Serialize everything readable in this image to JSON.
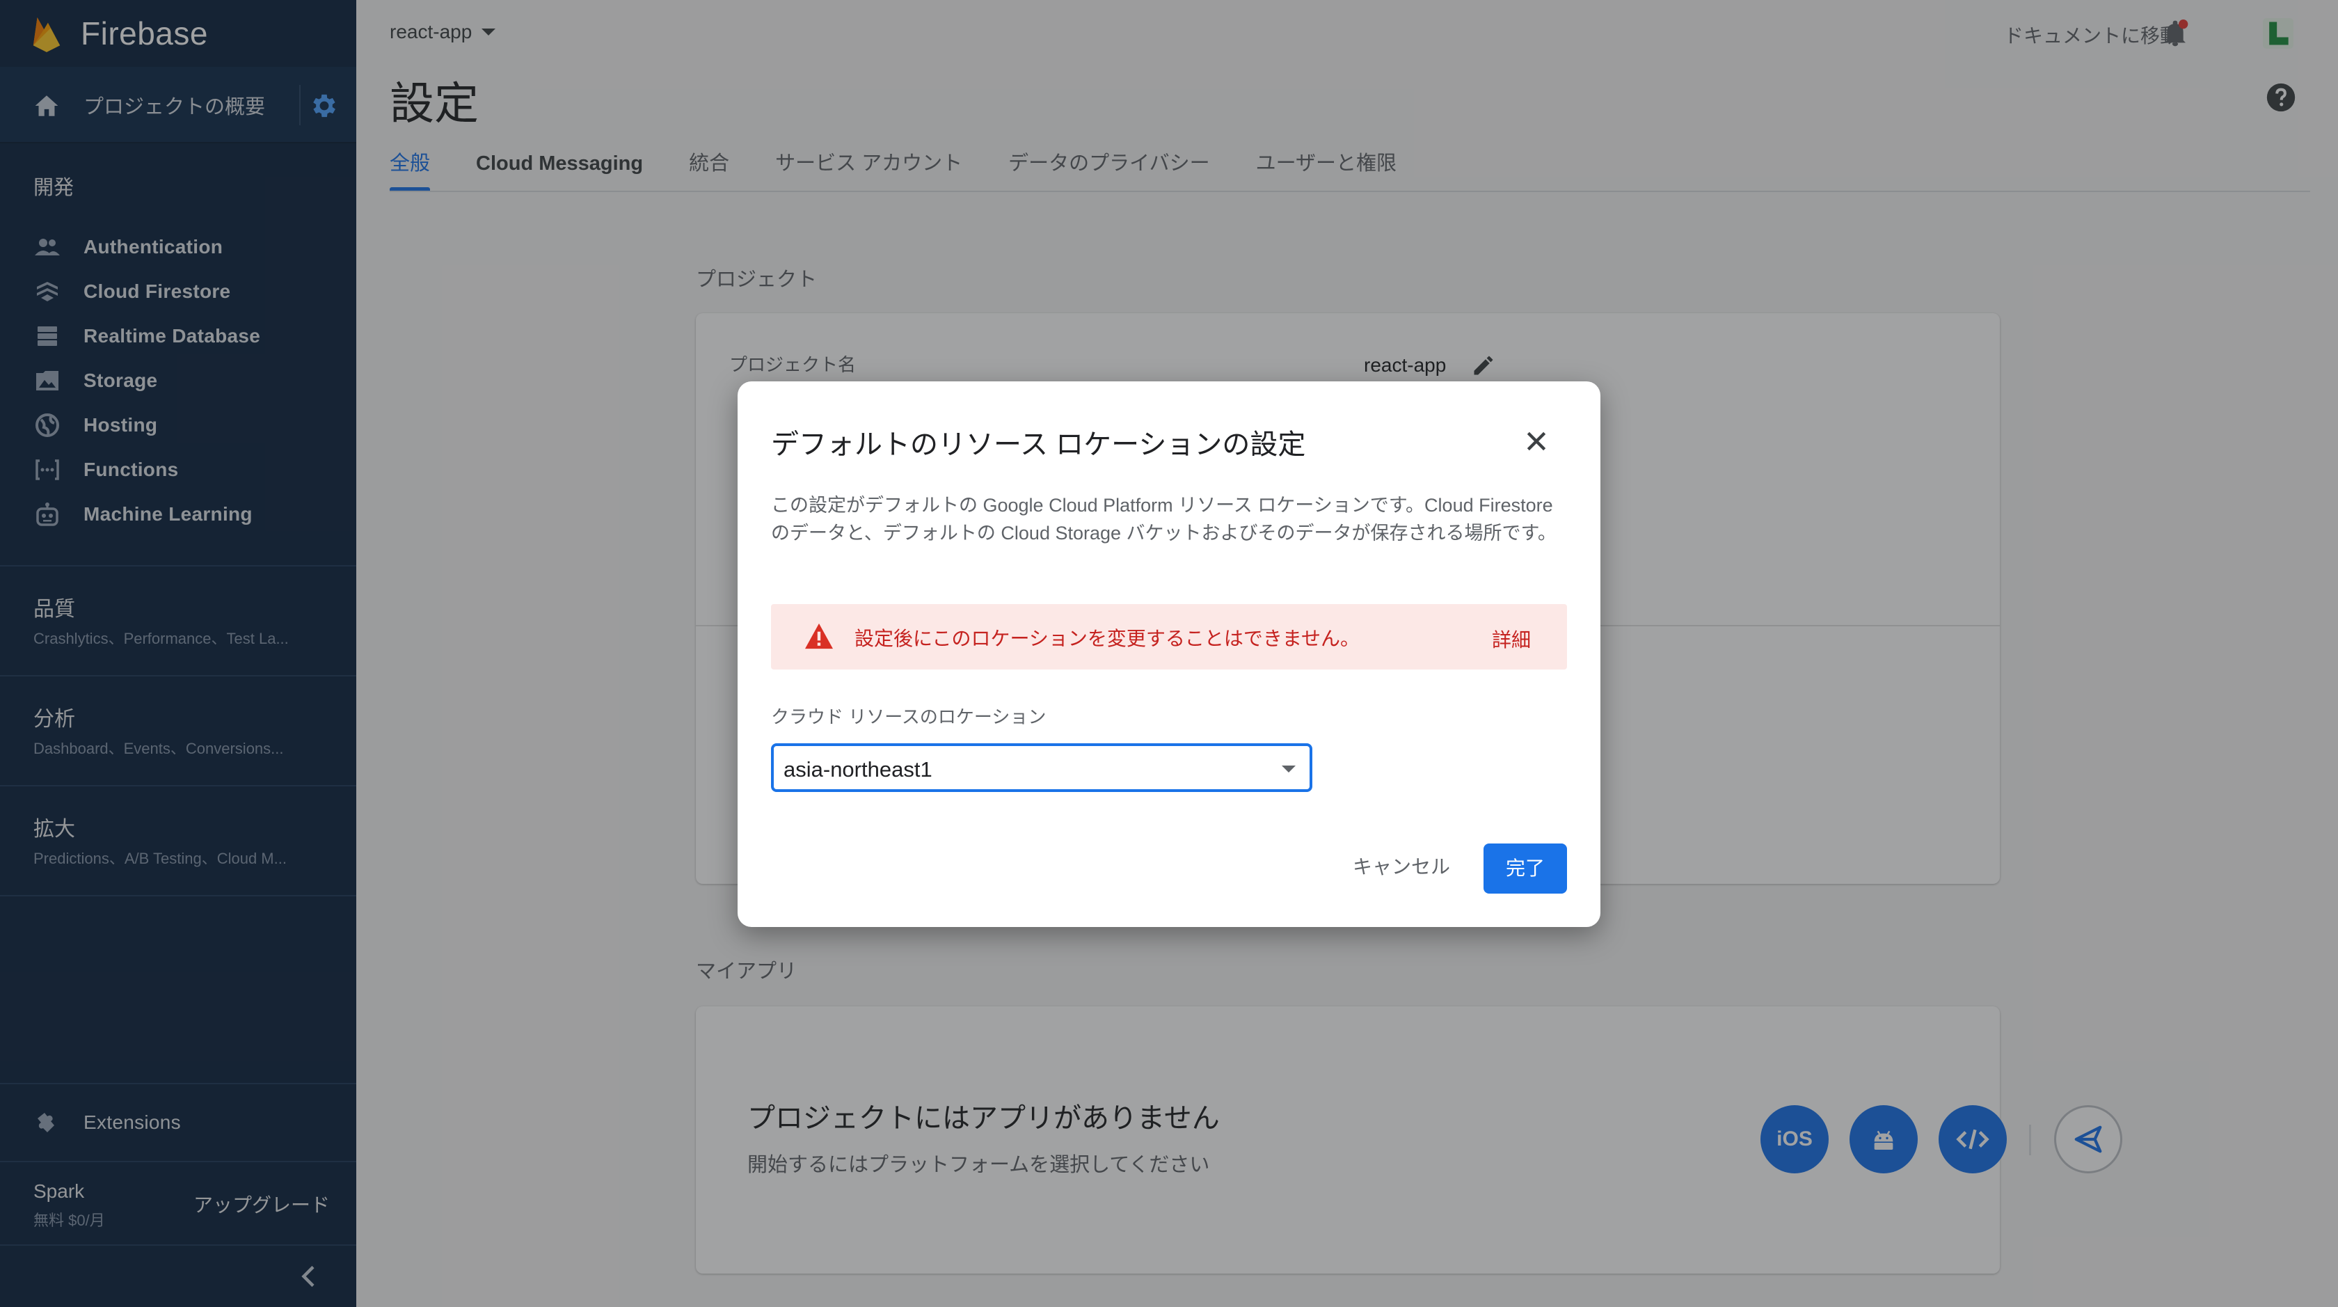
{
  "sidebar": {
    "brand": "Firebase",
    "overview_label": "プロジェクトの概要",
    "develop_title": "開発",
    "develop_items": [
      {
        "label": "Authentication",
        "icon": "users-icon"
      },
      {
        "label": "Cloud Firestore",
        "icon": "firestore-icon"
      },
      {
        "label": "Realtime Database",
        "icon": "database-icon"
      },
      {
        "label": "Storage",
        "icon": "image-icon"
      },
      {
        "label": "Hosting",
        "icon": "globe-icon"
      },
      {
        "label": "Functions",
        "icon": "functions-icon"
      },
      {
        "label": "Machine Learning",
        "icon": "robot-icon"
      }
    ],
    "groups": [
      {
        "title": "品質",
        "subtitle": "Crashlytics、Performance、Test La..."
      },
      {
        "title": "分析",
        "subtitle": "Dashboard、Events、Conversions..."
      },
      {
        "title": "拡大",
        "subtitle": "Predictions、A/B Testing、Cloud M..."
      }
    ],
    "extensions_label": "Extensions",
    "plan_name": "Spark",
    "plan_price": "無料 $0/月",
    "upgrade_label": "アップグレード"
  },
  "header": {
    "project_selector": "react-app",
    "docs_link": "ドキュメントに移動",
    "page_title": "設定"
  },
  "tabs": [
    {
      "label": "全般",
      "active": true
    },
    {
      "label": "Cloud Messaging",
      "active": false
    },
    {
      "label": "統合",
      "active": false
    },
    {
      "label": "サービス アカウント",
      "active": false
    },
    {
      "label": "データのプライバシー",
      "active": false
    },
    {
      "label": "ユーザーと権限",
      "active": false
    }
  ],
  "project_section": {
    "label": "プロジェクト",
    "name_label": "プロジェクト名",
    "name_value": "react-app"
  },
  "apps_section": {
    "label": "マイアプリ",
    "empty_title": "プロジェクトにはアプリがありません",
    "empty_subtitle": "開始するにはプラットフォームを選択してください",
    "ios_label": "iOS"
  },
  "dialog": {
    "title": "デフォルトのリソース ロケーションの設定",
    "body": "この設定がデフォルトの Google Cloud Platform リソース ロケーションです。Cloud Firestore のデータと、デフォルトの Cloud Storage バケットおよびそのデータが保存される場所です。",
    "warning": "設定後にこのロケーションを変更することはできません。",
    "warning_link": "詳細",
    "field_label": "クラウド リソースのロケーション",
    "selected_location": "asia-northeast1",
    "cancel_label": "キャンセル",
    "done_label": "完了"
  },
  "colors": {
    "sidebar_bg": "#0f2540",
    "accent": "#1a73e8",
    "warning_bg": "#fce8e6",
    "warning_text": "#c5221f"
  }
}
